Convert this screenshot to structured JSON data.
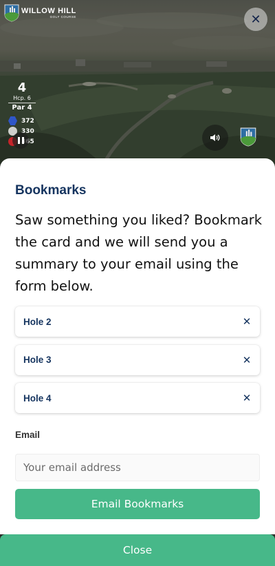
{
  "video": {
    "logo_name": "WILLOW HILL",
    "logo_sub": "GOLF COURSE",
    "close_glyph": "✕",
    "hole_number": "4",
    "handicap": "Hcp. 6",
    "par": "Par 4",
    "tees": [
      {
        "color": "blue",
        "yards": "372"
      },
      {
        "color": "white",
        "yards": "330"
      },
      {
        "color": "red",
        "yards": "365"
      }
    ],
    "icons": [
      "willow-hill-logo-icon",
      "close-icon",
      "pause-icon",
      "speaker-icon",
      "willow-hill-mini-logo-icon"
    ]
  },
  "bookmarks": {
    "title": "Bookmarks",
    "description": "Saw something you liked? Bookmark the card and we will send you a summary to your email using the form below.",
    "items": [
      {
        "label": "Hole 2",
        "remove_glyph": "✕"
      },
      {
        "label": "Hole 3",
        "remove_glyph": "✕"
      },
      {
        "label": "Hole 4",
        "remove_glyph": "✕"
      }
    ],
    "email_label": "Email",
    "email_placeholder": "Your email address",
    "email_value": "",
    "submit_label": "Email Bookmarks",
    "close_label": "Close"
  },
  "colors": {
    "title_navy": "#15345f",
    "accent_green": "#47b889",
    "tee_blue": "#2f56c8",
    "tee_red": "#c5242a"
  }
}
